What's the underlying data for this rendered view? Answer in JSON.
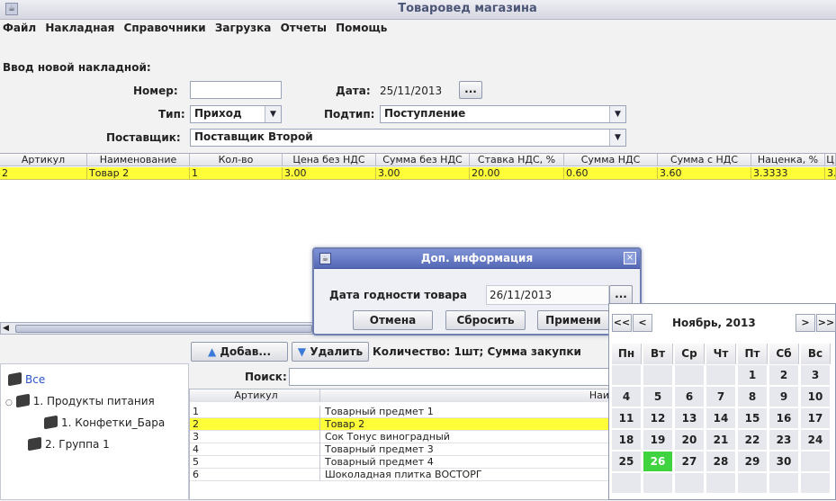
{
  "window": {
    "title": "Товаровед магазина",
    "icon": "app-icon"
  },
  "menu": [
    "Файл",
    "Накладная",
    "Справочники",
    "Загрузка",
    "Отчеты",
    "Помощь"
  ],
  "form": {
    "heading": "Ввод новой накладной:",
    "number_label": "Номер:",
    "number_value": "",
    "date_label": "Дата:",
    "date_value": "25/11/2013",
    "date_button": "...",
    "type_label": "Тип:",
    "type_value": "Приход",
    "subtype_label": "Подтип:",
    "subtype_value": "Поступление",
    "supplier_label": "Поставщик:",
    "supplier_value": "Поставщик Второй"
  },
  "invoice_table": {
    "columns": [
      "Артикул",
      "Наименование",
      "Кол-во",
      "Цена без НДС",
      "Сумма без НДС",
      "Ставка НДС, %",
      "Сумма НДС",
      "Сумма с НДС",
      "Наценка, %",
      "Ц"
    ],
    "rows": [
      [
        "2",
        "Товар 2",
        "1",
        "3.00",
        "3.00",
        "20.00",
        "0.60",
        "3.60",
        "3.3333",
        "3."
      ]
    ]
  },
  "actions": {
    "add_label": "Добав...",
    "delete_label": "Удалить",
    "summary": "Количество: 1шт; Сумма закупки"
  },
  "tree": {
    "items": [
      {
        "label": "Все"
      },
      {
        "label": "1. Продукты питания"
      },
      {
        "label": "1. Конфетки_Бара"
      },
      {
        "label": "2. Группа 1"
      }
    ]
  },
  "search": {
    "label": "Поиск:",
    "value": ""
  },
  "products": {
    "columns": [
      "Артикул",
      "Наи"
    ],
    "rows": [
      [
        "1",
        "Товарный предмет 1"
      ],
      [
        "2",
        "Товар 2"
      ],
      [
        "3",
        "Сок Тонус виноградный"
      ],
      [
        "4",
        "Товарный предмет 3"
      ],
      [
        "5",
        "Товарный предмет 4"
      ],
      [
        "6",
        "Шоколадная плитка ВОСТОРГ"
      ]
    ],
    "selected_index": 1
  },
  "dialog": {
    "title": "Доп. информация",
    "expiry_label": "Дата годности товара",
    "expiry_value": "26/11/2013",
    "date_button": "...",
    "cancel": "Отмена",
    "reset": "Сбросить",
    "apply": "Примени"
  },
  "calendar": {
    "prev_year": "<<",
    "prev_month": "<",
    "month": "Ноябрь, 2013",
    "next_month": ">",
    "next_year": ">>",
    "weekdays": [
      "Пн",
      "Вт",
      "Ср",
      "Чт",
      "Пт",
      "Сб",
      "Вс"
    ],
    "weeks": [
      [
        "",
        "",
        "",
        "",
        "1",
        "2",
        "3"
      ],
      [
        "4",
        "5",
        "6",
        "7",
        "8",
        "9",
        "10"
      ],
      [
        "11",
        "12",
        "13",
        "14",
        "15",
        "16",
        "17"
      ],
      [
        "18",
        "19",
        "20",
        "21",
        "22",
        "23",
        "24"
      ],
      [
        "25",
        "26",
        "27",
        "28",
        "29",
        "30",
        ""
      ],
      [
        "",
        "",
        "",
        "",
        "",
        "",
        ""
      ]
    ],
    "selected_day": "26",
    "highlight_color": "#3fd33f"
  },
  "colors": {
    "selection": "#ffff39",
    "dialog_title": "#5468b5"
  }
}
